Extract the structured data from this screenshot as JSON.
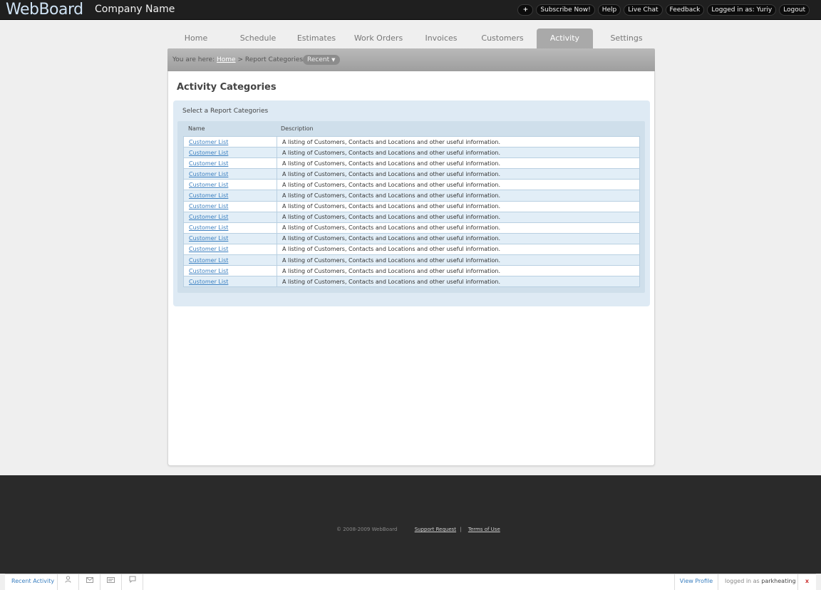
{
  "header": {
    "logo": "WebBoard",
    "company": "Company Name",
    "links": [
      "+",
      "Subscribe Now!",
      "Help",
      "Live Chat",
      "Feedback",
      "Logged in as: Yuriy",
      "Logout"
    ]
  },
  "nav": {
    "tabs": [
      "Home",
      "Schedule",
      "Estimates",
      "Work Orders",
      "Invoices",
      "Customers",
      "Activity",
      "Settings"
    ],
    "active": "Activity"
  },
  "breadcrumb": {
    "prefix": "You are here:",
    "home": "Home",
    "separator": ">",
    "current": "Report Categories",
    "recent_label": "Recent"
  },
  "main": {
    "title": "Activity Categories",
    "select_label": "Select a Report Categories",
    "columns": [
      "Name",
      "Description"
    ],
    "rows": [
      {
        "name": "Customer List",
        "description": "A listing of Customers, Contacts and Locations and other useful information."
      },
      {
        "name": "Customer List",
        "description": "A listing of Customers, Contacts and Locations and other useful information."
      },
      {
        "name": "Customer List",
        "description": "A listing of Customers, Contacts and Locations and other useful information."
      },
      {
        "name": "Customer List",
        "description": "A listing of Customers, Contacts and Locations and other useful information."
      },
      {
        "name": "Customer List",
        "description": "A listing of Customers, Contacts and Locations and other useful information."
      },
      {
        "name": "Customer List",
        "description": "A listing of Customers, Contacts and Locations and other useful information."
      },
      {
        "name": "Customer List",
        "description": "A listing of Customers, Contacts and Locations and other useful information."
      },
      {
        "name": "Customer List",
        "description": "A listing of Customers, Contacts and Locations and other useful information."
      },
      {
        "name": "Customer List",
        "description": "A listing of Customers, Contacts and Locations and other useful information."
      },
      {
        "name": "Customer List",
        "description": "A listing of Customers, Contacts and Locations and other useful information."
      },
      {
        "name": "Customer List",
        "description": "A listing of Customers, Contacts and Locations and other useful information."
      },
      {
        "name": "Customer List",
        "description": "A listing of Customers, Contacts and Locations and other useful information."
      },
      {
        "name": "Customer List",
        "description": "A listing of Customers, Contacts and Locations and other useful information."
      },
      {
        "name": "Customer List",
        "description": "A listing of Customers, Contacts and Locations and other useful information."
      }
    ]
  },
  "footer": {
    "copyright": "© 2008-2009 WebBoard",
    "support": "Support Request",
    "separator": "|",
    "terms": "Terms of Use"
  },
  "bottombar": {
    "recent_activity": "Recent Activity",
    "icons": [
      "user-icon",
      "mail-icon",
      "card-icon",
      "chat-icon"
    ],
    "view_profile": "View Profile",
    "logged_prefix": "logged in as",
    "logged_user": "parkheating",
    "close": "x"
  },
  "colors": {
    "accent_link": "#3a7fc0",
    "tab_active": "#a9a9a9",
    "panel_bg": "#deeaf4",
    "header_bg": "#1f1f1f"
  }
}
